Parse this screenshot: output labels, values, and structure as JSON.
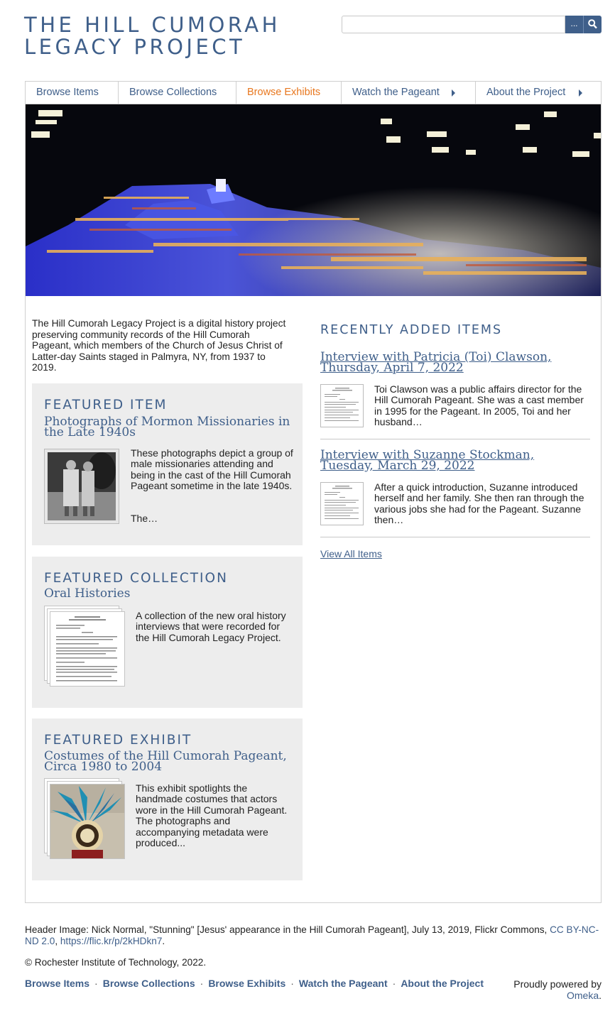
{
  "site": {
    "title_line1": "THE HILL CUMORAH",
    "title_line2": "LEGACY PROJECT"
  },
  "search": {
    "placeholder": "",
    "advanced_label": "...",
    "submit_icon": "search-icon"
  },
  "nav": {
    "items": [
      {
        "label": "Browse Items",
        "active": false,
        "has_submenu": false
      },
      {
        "label": "Browse Collections",
        "active": false,
        "has_submenu": false
      },
      {
        "label": "Browse Exhibits",
        "active": true,
        "has_submenu": false
      },
      {
        "label": "Watch the Pageant",
        "active": false,
        "has_submenu": true
      },
      {
        "label": "About the Project",
        "active": false,
        "has_submenu": true
      }
    ]
  },
  "intro": {
    "text": "The Hill Cumorah Legacy Project is a digital history project preserving community records of the Hill Cumorah Pageant, which members of the Church of Jesus Christ of Latter-day Saints staged in Palmyra, NY, from 1937 to 2019."
  },
  "featured_item": {
    "heading": "FEATURED ITEM",
    "title": "Photographs of Mormon Missionaries in the Late 1940s",
    "text": "These photographs depict a group of male missionaries attending and being in the cast of the Hill Cumorah Pageant sometime in the late 1940s.",
    "more": "The…"
  },
  "featured_collection": {
    "heading": "FEATURED COLLECTION",
    "title": "Oral Histories",
    "text": "A collection of the new oral history interviews that were recorded for the Hill Cumorah Legacy Project."
  },
  "featured_exhibit": {
    "heading": "FEATURED EXHIBIT",
    "title": "Costumes of the Hill Cumorah Pageant, Circa 1980 to 2004",
    "text": "This exhibit spotlights the handmade costumes that actors wore in the Hill Cumorah Pageant. The photographs and accompanying metadata were produced..."
  },
  "recent": {
    "heading": "RECENTLY ADDED ITEMS",
    "items": [
      {
        "title": "Interview with Patricia (Toi) Clawson, Thursday, April 7, 2022",
        "text": "Toi Clawson was a public affairs director for the Hill Cumorah Pageant. She was a cast member in 1995 for the Pageant. In 2005, Toi and her husband…"
      },
      {
        "title": "Interview with Suzanne Stockman, Tuesday, March 29, 2022",
        "text": "After a quick introduction, Suzanne introduced herself and her family. She then ran through the various jobs she had for the Pageant. Suzanne then…"
      }
    ],
    "view_all": "View All Items"
  },
  "footer": {
    "credit_prefix": "Header Image: Nick Normal, \"Stunning\" [Jesus' appearance in the Hill Cumorah Pageant], July 13, 2019, Flickr Commons, ",
    "license_link": "CC BY-NC-ND 2.0",
    "sep": ", ",
    "flickr_link": "https://flic.kr/p/2kHDkn7",
    "end": ".",
    "copyright": "© Rochester Institute of Technology, 2022.",
    "nav": [
      "Browse Items",
      "Browse Collections",
      "Browse Exhibits",
      "Watch the Pageant",
      "About the Project"
    ],
    "separator": "·",
    "powered_prefix": "Proudly powered by ",
    "powered_link": "Omeka",
    "powered_suffix": "."
  },
  "colors": {
    "brand": "#3f5f8a",
    "active_nav": "#e8771e",
    "panel_bg": "#ededed"
  }
}
